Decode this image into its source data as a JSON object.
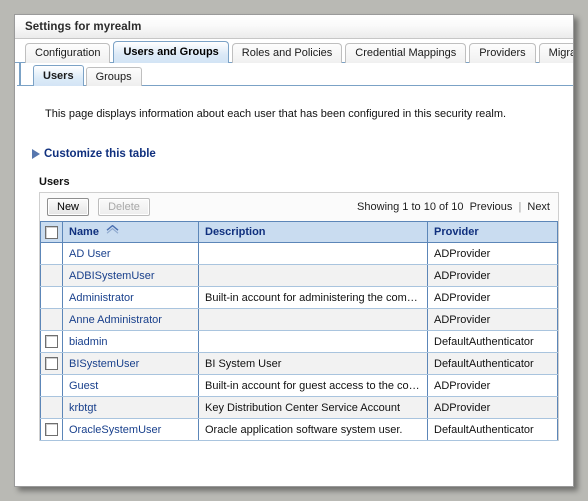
{
  "window": {
    "title": "Settings for myrealm"
  },
  "primary_tabs": [
    {
      "label": "Configuration",
      "active": false
    },
    {
      "label": "Users and Groups",
      "active": true
    },
    {
      "label": "Roles and Policies",
      "active": false
    },
    {
      "label": "Credential Mappings",
      "active": false
    },
    {
      "label": "Providers",
      "active": false
    },
    {
      "label": "Migration",
      "active": false
    }
  ],
  "secondary_tabs": [
    {
      "label": "Users",
      "active": true
    },
    {
      "label": "Groups",
      "active": false
    }
  ],
  "content": {
    "intro": "This page displays information about each user that has been configured in this security realm.",
    "customize_link": "Customize this table",
    "section_title": "Users"
  },
  "toolbar": {
    "new_label": "New",
    "delete_label": "Delete",
    "delete_disabled": true,
    "showing_text": "Showing 1 to 10 of 10",
    "previous_label": "Previous",
    "next_label": "Next",
    "separator": "|"
  },
  "table": {
    "columns": [
      "Name",
      "Description",
      "Provider"
    ],
    "sort_column": "Name",
    "sort_direction": "ascending",
    "rows": [
      {
        "checkbox": false,
        "name": "AD User",
        "description": "",
        "provider": "ADProvider"
      },
      {
        "checkbox": false,
        "name": "ADBISystemUser",
        "description": "",
        "provider": "ADProvider"
      },
      {
        "checkbox": false,
        "name": "Administrator",
        "description": "Built-in account for administering the computer/domain",
        "provider": "ADProvider"
      },
      {
        "checkbox": false,
        "name": "Anne Administrator",
        "description": "",
        "provider": "ADProvider"
      },
      {
        "checkbox": true,
        "name": "biadmin",
        "description": "",
        "provider": "DefaultAuthenticator"
      },
      {
        "checkbox": true,
        "name": "BISystemUser",
        "description": "BI System User",
        "provider": "DefaultAuthenticator"
      },
      {
        "checkbox": false,
        "name": "Guest",
        "description": "Built-in account for guest access to the computer/domain",
        "provider": "ADProvider"
      },
      {
        "checkbox": false,
        "name": "krbtgt",
        "description": "Key Distribution Center Service Account",
        "provider": "ADProvider"
      },
      {
        "checkbox": true,
        "name": "OracleSystemUser",
        "description": "Oracle application software system user.",
        "provider": "DefaultAuthenticator"
      }
    ]
  },
  "colors": {
    "accent_blue": "#10307e",
    "link_blue": "#19408c",
    "header_bg": "#c9dcf0",
    "active_tab_bg": "#d3e4f5",
    "grid_border": "#5c86b8"
  }
}
